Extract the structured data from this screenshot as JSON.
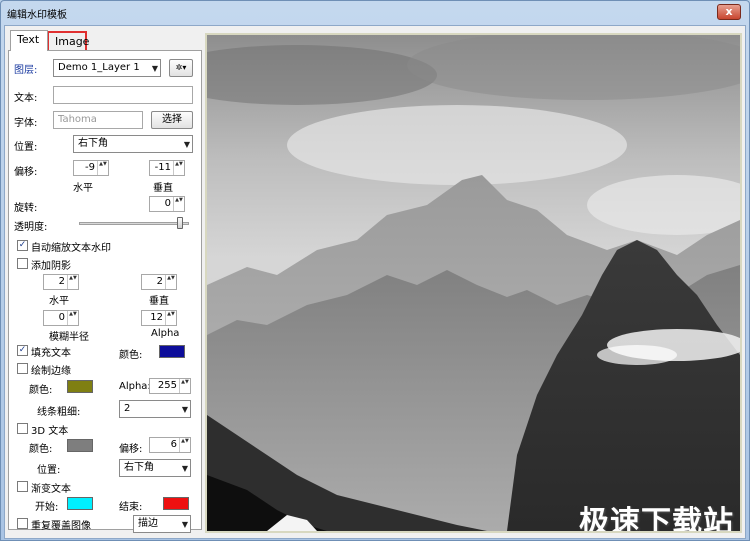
{
  "window": {
    "title": "编辑水印模板",
    "close_label": "x"
  },
  "tabs": [
    {
      "label": "Text",
      "active": true
    },
    {
      "label": "Image",
      "active": false,
      "highlighted": true
    }
  ],
  "layer": {
    "label": "图层:",
    "value": "Demo 1_Layer 1",
    "gear_label": "✲▾"
  },
  "text_field": {
    "label": "文本:",
    "value": ""
  },
  "font": {
    "label": "字体:",
    "placeholder": "Tahoma",
    "button_label": "选择"
  },
  "position": {
    "label": "位置:",
    "value": "右下角"
  },
  "offset": {
    "label": "偏移:",
    "horizontal": {
      "value": "-9",
      "label": "水平"
    },
    "vertical": {
      "value": "-11",
      "label": "垂直"
    }
  },
  "rotation": {
    "label": "旋转:",
    "value": "0"
  },
  "transparency": {
    "label": "透明度:",
    "level": 0.92
  },
  "auto_scale": {
    "label": "自动缩放文本水印",
    "checked": true,
    "mark": "✓"
  },
  "shadow": {
    "label": "添加阴影",
    "checked": false,
    "horizontal": {
      "value": "2",
      "label": "水平"
    },
    "vertical": {
      "value": "2",
      "label": "垂直"
    },
    "blur": {
      "value": "0",
      "label": "模糊半径"
    },
    "alpha": {
      "value": "12",
      "label": "Alpha"
    }
  },
  "fill": {
    "label": "填充文本",
    "checked": true,
    "mark": "✓",
    "color_label": "颜色:",
    "color": "#0d0d9a"
  },
  "outline": {
    "label": "绘制边缘",
    "checked": false,
    "color_label": "颜色:",
    "color": "#7f7f12",
    "alpha_label": "Alpha:",
    "alpha_value": "255",
    "width_label": "线条粗细:",
    "width_value": "2"
  },
  "text3d": {
    "label": "3D 文本",
    "checked": false,
    "color_label": "颜色:",
    "color": "#7e7e7e",
    "offset_label": "偏移:",
    "offset_value": "6",
    "position_label": "位置:",
    "position_value": "右下角"
  },
  "gradient": {
    "label": "渐变文本",
    "checked": false,
    "start_label": "开始:",
    "start_color": "#00f0ff",
    "end_label": "结束:",
    "end_color": "#ee1010"
  },
  "repeat": {
    "label": "重复覆盖图像",
    "checked": false,
    "mode_value": "描边"
  },
  "preview": {
    "watermark_text": "极速下载站"
  },
  "arrows": {
    "down": "▼",
    "spin": "▲▼"
  }
}
